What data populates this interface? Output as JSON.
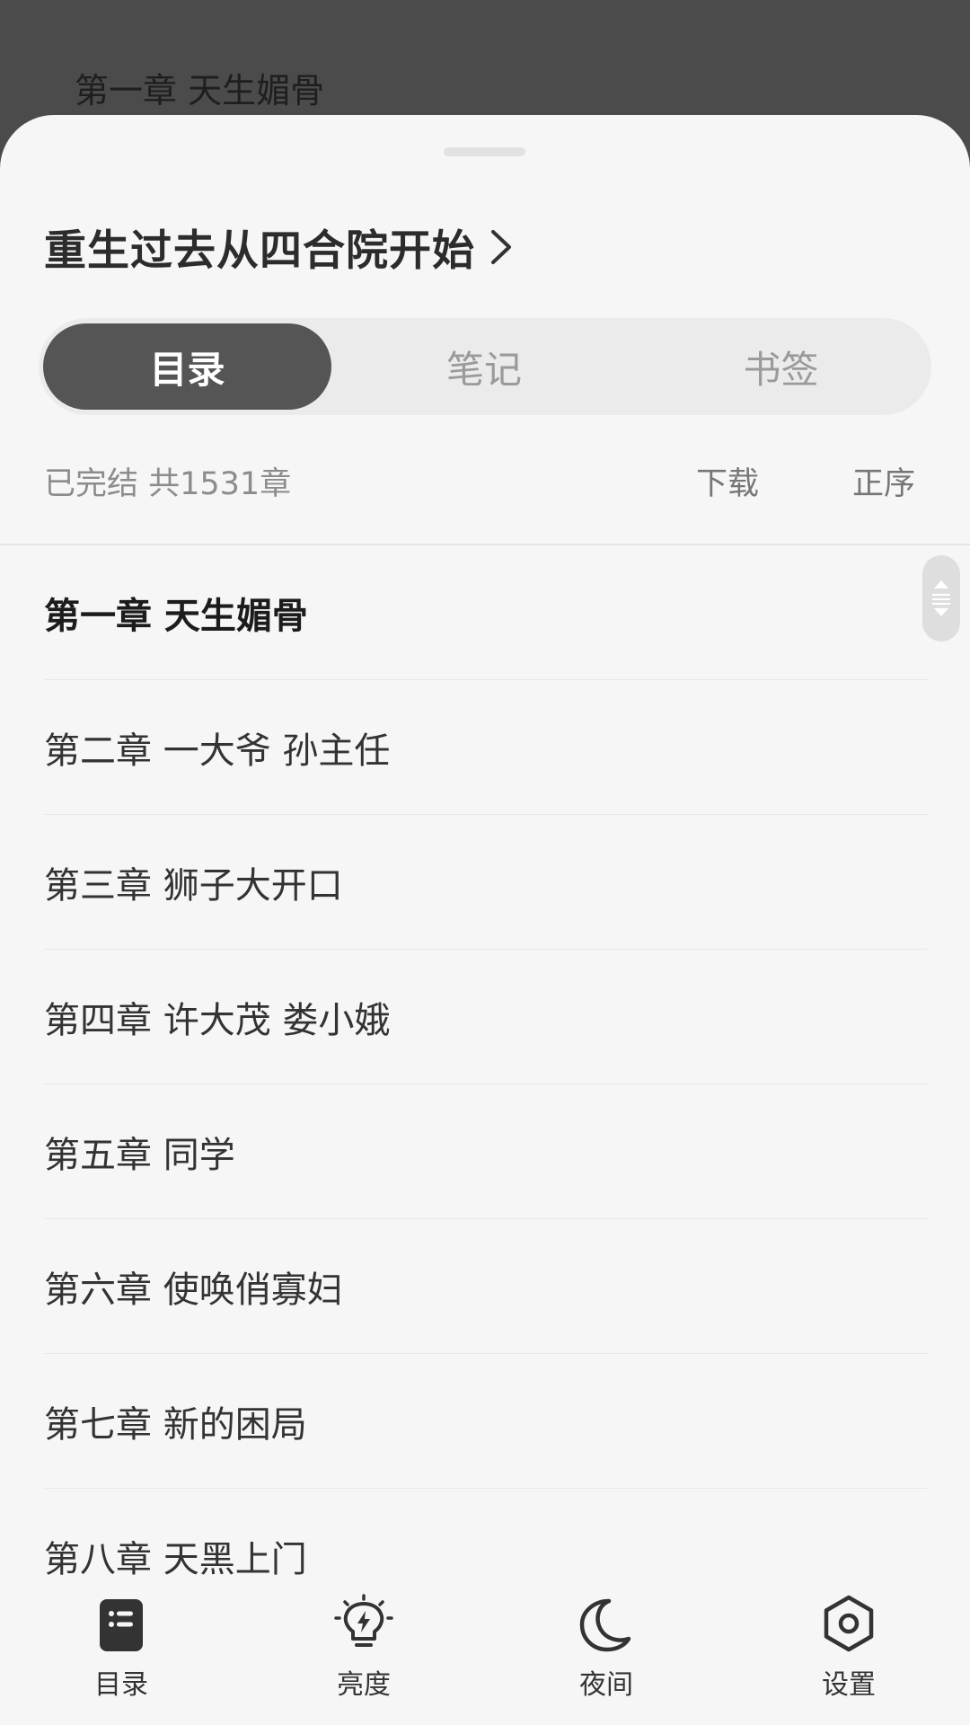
{
  "background": {
    "chapter_title": "第一章 天生媚骨"
  },
  "book": {
    "title": "重生过去从四合院开始"
  },
  "tabs": [
    {
      "label": "目录"
    },
    {
      "label": "笔记"
    },
    {
      "label": "书签"
    }
  ],
  "meta": {
    "status": "已完结 共1531章",
    "download_label": "下载",
    "order_label": "正序"
  },
  "chapters": [
    "第一章 天生媚骨",
    "第二章 一大爷 孙主任",
    "第三章 狮子大开口",
    "第四章 许大茂 娄小娥",
    "第五章 同学",
    "第六章 使唤俏寡妇",
    "第七章 新的困局",
    "第八章 天黑上门"
  ],
  "bottom_nav": [
    {
      "label": "目录",
      "icon": "catalog-icon"
    },
    {
      "label": "亮度",
      "icon": "brightness-icon"
    },
    {
      "label": "夜间",
      "icon": "moon-icon"
    },
    {
      "label": "设置",
      "icon": "settings-icon"
    }
  ]
}
